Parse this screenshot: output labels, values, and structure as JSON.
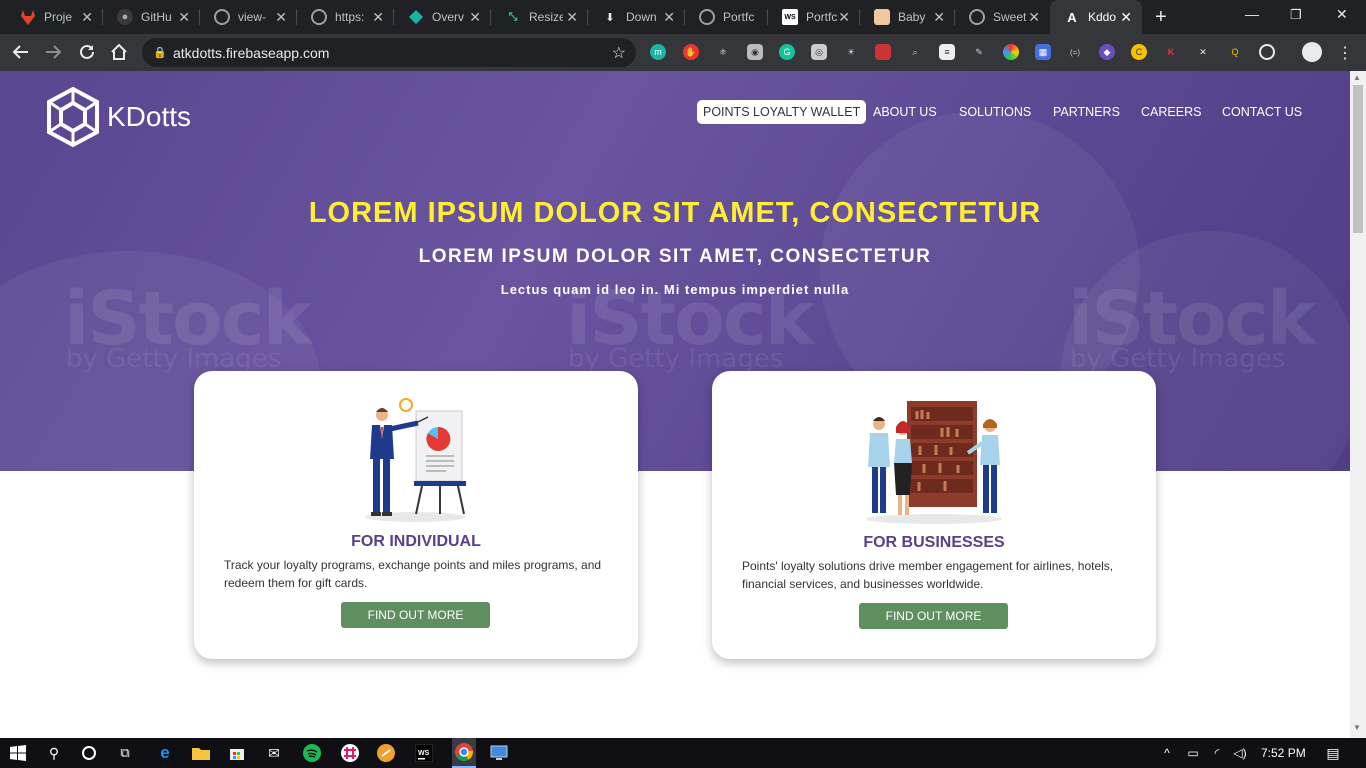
{
  "browser": {
    "tabs": [
      {
        "title": "Proje",
        "favicon": "gitlab-icon",
        "color": "#e24329"
      },
      {
        "title": "GitHu",
        "favicon": "github-icon",
        "color": "#999999"
      },
      {
        "title": "view-",
        "favicon": "globe-icon",
        "color": "#9aa0a6"
      },
      {
        "title": "https:",
        "favicon": "globe-icon",
        "color": "#9aa0a6"
      },
      {
        "title": "Overv",
        "favicon": "diamond-icon",
        "color": "#1bb5a8"
      },
      {
        "title": "Resize",
        "favicon": "resize-icon",
        "color": "#34c37a"
      },
      {
        "title": "Down",
        "favicon": "download-icon",
        "color": "#e8eaed"
      },
      {
        "title": "Portfc",
        "favicon": "globe-icon",
        "color": "#9aa0a6"
      },
      {
        "title": "Portfc",
        "favicon": "webstorm-icon",
        "color": "#ffffff"
      },
      {
        "title": "Baby",
        "favicon": "baby-icon",
        "color": "#f0c8a0"
      },
      {
        "title": "Sweet",
        "favicon": "globe-icon",
        "color": "#9aa0a6"
      },
      {
        "title": "Kddo",
        "favicon": "angular-icon",
        "color": "#ffffff"
      }
    ],
    "url": "atkdotts.firebaseapp.com"
  },
  "site": {
    "brand": "KDotts",
    "nav": [
      "POINTS LOYALTY WALLET",
      "ABOUT US",
      "SOLUTIONS",
      "PARTNERS",
      "CAREERS",
      "CONTACT US"
    ],
    "hero_title": "LOREM IPSUM DOLOR SIT AMET, CONSECTETUR",
    "hero_subtitle": "LOREM IPSUM DOLOR SIT AMET, CONSECTETUR",
    "hero_tagline": "Lectus quam id leo in. Mi tempus imperdiet nulla",
    "watermark": "iStock",
    "watermark_sub": "by Getty Images",
    "cards": [
      {
        "title": "FOR INDIVIDUAL",
        "desc": "Track your loyalty programs, exchange points and miles programs, and redeem them for gift cards.",
        "button": "FIND OUT MORE"
      },
      {
        "title": "FOR BUSINESSES",
        "desc": "Points' loyalty solutions drive member engagement for airlines, hotels, financial services, and businesses worldwide.",
        "button": "FIND OUT MORE"
      }
    ]
  },
  "taskbar": {
    "time": "7:52 PM"
  }
}
